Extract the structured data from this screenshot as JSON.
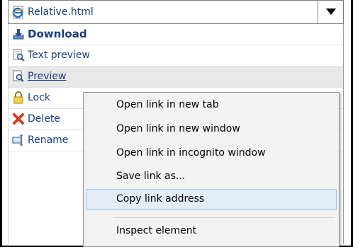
{
  "file": {
    "name": "Relative.html",
    "icon": "ie-html-file-icon"
  },
  "menu": {
    "items": [
      {
        "label": "Download",
        "icon": "download-icon"
      },
      {
        "label": "Text preview",
        "icon": "text-preview-icon"
      },
      {
        "label": "Preview",
        "icon": "preview-icon"
      },
      {
        "label": "Lock",
        "icon": "lock-icon"
      },
      {
        "label": "Delete",
        "icon": "delete-icon"
      },
      {
        "label": "Rename",
        "icon": "rename-icon"
      }
    ]
  },
  "context_menu": {
    "items": [
      {
        "label": "Open link in new tab"
      },
      {
        "label": "Open link in new window"
      },
      {
        "label": "Open link in incognito window"
      },
      {
        "label": "Save link as..."
      },
      {
        "label": "Copy link address"
      },
      {
        "label": "Inspect element"
      }
    ],
    "highlighted": "Copy link address"
  },
  "colors": {
    "link_blue": "#1a3c80",
    "hover_row": "#e8e8e8",
    "context_bg": "#f2f2f2",
    "highlight_bg": "#e3edf8",
    "highlight_border": "#9fc3e8"
  }
}
